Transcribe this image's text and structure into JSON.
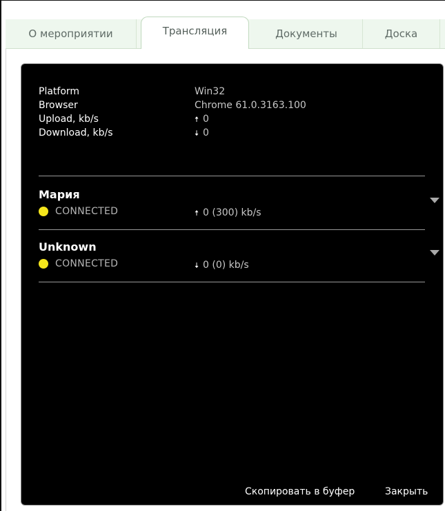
{
  "tabs": [
    {
      "label": "О мероприятии"
    },
    {
      "label": "Трансляция",
      "active": true
    },
    {
      "label": "Документы"
    },
    {
      "label": "Доска"
    }
  ],
  "info": [
    {
      "label": "Platform",
      "value": "Win32"
    },
    {
      "label": "Browser",
      "value": "Chrome 61.0.3163.100"
    },
    {
      "label": "Upload, kb/s",
      "value": "0",
      "icon": "arrow-up-icon"
    },
    {
      "label": "Download, kb/s",
      "value": "0",
      "icon": "arrow-down-icon"
    }
  ],
  "participants": [
    {
      "name": "Мария",
      "status": "CONNECTED",
      "rate": "0 (300) kb/s",
      "direction_icon": "arrow-up-icon",
      "status_color": "#f5e61c"
    },
    {
      "name": "Unknown",
      "status": "CONNECTED",
      "rate": "0 (0) kb/s",
      "direction_icon": "arrow-down-icon",
      "status_color": "#f5e61c"
    }
  ],
  "footer": {
    "copy_label": "Скопировать в буфер",
    "close_label": "Закрыть"
  },
  "icons": {
    "expand": "chevron-down-icon",
    "status": "status-dot-icon"
  },
  "colors": {
    "panel_bg": "#000000",
    "tab_bg": "#eef7ee",
    "status_connected": "#f5e61c"
  }
}
